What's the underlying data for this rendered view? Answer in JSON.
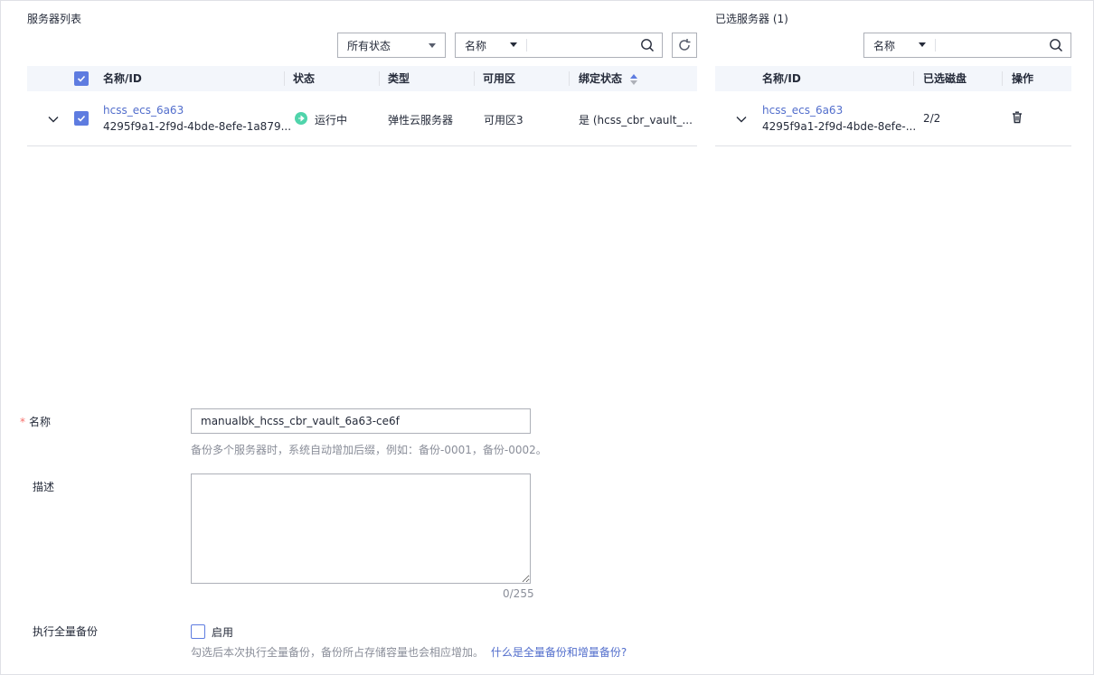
{
  "left_panel": {
    "title": "服务器列表",
    "status_filter": "所有状态",
    "search_field": "名称",
    "search_placeholder": "",
    "columns": [
      "名称/ID",
      "状态",
      "类型",
      "可用区",
      "绑定状态"
    ],
    "rows": [
      {
        "name": "hcss_ecs_6a63",
        "id": "4295f9a1-2f9d-4bde-8efe-1a879...",
        "status": "运行中",
        "type": "弹性云服务器",
        "zone": "可用区3",
        "binding": "是 (hcss_cbr_vault_..."
      }
    ]
  },
  "right_panel": {
    "title": "已选服务器 (1)",
    "search_field": "名称",
    "search_placeholder": "",
    "columns": [
      "名称/ID",
      "已选磁盘",
      "操作"
    ],
    "rows": [
      {
        "name": "hcss_ecs_6a63",
        "id": "4295f9a1-2f9d-4bde-8efe-...",
        "disks": "2/2"
      }
    ]
  },
  "form": {
    "name_label": "名称",
    "name_value": "manualbk_hcss_cbr_vault_6a63-ce6f",
    "name_hint": "备份多个服务器时，系统自动增加后缀，例如：备份-0001，备份-0002。",
    "desc_label": "描述",
    "desc_value": "",
    "desc_counter": "0/255",
    "full_backup_label": "执行全量备份",
    "full_backup_option": "启用",
    "full_backup_hint": "勾选后本次执行全量备份，备份所占存储容量也会相应增加。",
    "full_backup_link": "什么是全量备份和增量备份?"
  },
  "colors": {
    "accent": "#5e7ce0",
    "link": "#526ecc",
    "running": "#50d4ab",
    "required": "#f66f6a"
  }
}
